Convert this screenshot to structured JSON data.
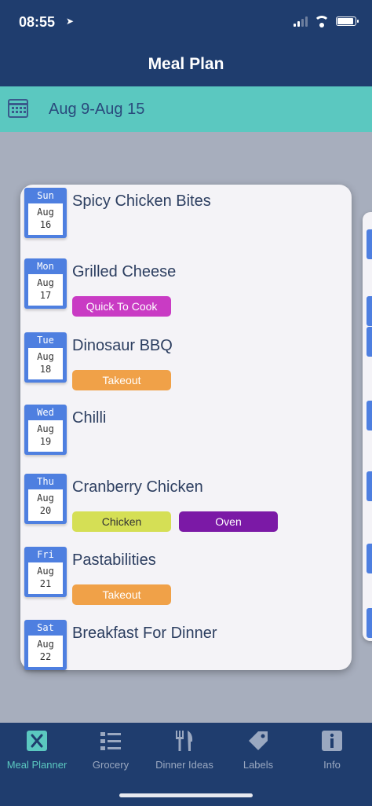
{
  "status_bar": {
    "time": "08:55",
    "location_icon": "location-arrow-icon"
  },
  "nav": {
    "title": "Meal Plan"
  },
  "week": {
    "range": "Aug 9-Aug 15",
    "icon": "calendar-icon"
  },
  "colors": {
    "nav_bg": "#1f3d6e",
    "accent_teal": "#5bc8c0",
    "date_chip": "#4e7fe0",
    "tag_magenta": "#c93bc4",
    "tag_orange": "#f0a148",
    "tag_yellow": "#d5df55",
    "tag_purple": "#7b19a6"
  },
  "days": [
    {
      "dow": "Sun",
      "month": "Aug",
      "day": "16",
      "meal": "Spicy Chicken Bites",
      "tags": []
    },
    {
      "dow": "Mon",
      "month": "Aug",
      "day": "17",
      "meal": "Grilled Cheese",
      "tags": [
        {
          "label": "Quick To Cook",
          "color": "#c93bc4",
          "text_color": "#ffffff"
        }
      ]
    },
    {
      "dow": "Tue",
      "month": "Aug",
      "day": "18",
      "meal": "Dinosaur BBQ",
      "tags": [
        {
          "label": "Takeout",
          "color": "#f0a148",
          "text_color": "#ffffff"
        }
      ]
    },
    {
      "dow": "Wed",
      "month": "Aug",
      "day": "19",
      "meal": "Chilli",
      "tags": []
    },
    {
      "dow": "Thu",
      "month": "Aug",
      "day": "20",
      "meal": "Cranberry Chicken",
      "tags": [
        {
          "label": "Chicken",
          "color": "#d5df55",
          "text_color": "#333333"
        },
        {
          "label": "Oven",
          "color": "#7b19a6",
          "text_color": "#ffffff"
        }
      ]
    },
    {
      "dow": "Fri",
      "month": "Aug",
      "day": "21",
      "meal": "Pastabilities",
      "tags": [
        {
          "label": "Takeout",
          "color": "#f0a148",
          "text_color": "#ffffff"
        }
      ]
    },
    {
      "dow": "Sat",
      "month": "Aug",
      "day": "22",
      "meal": "Breakfast For Dinner",
      "tags": []
    }
  ],
  "tabs": [
    {
      "label": "Meal Planner",
      "icon": "meal-planner-icon",
      "active": true
    },
    {
      "label": "Grocery",
      "icon": "grocery-list-icon",
      "active": false
    },
    {
      "label": "Dinner Ideas",
      "icon": "fork-knife-icon",
      "active": false
    },
    {
      "label": "Labels",
      "icon": "tag-icon",
      "active": false
    },
    {
      "label": "Info",
      "icon": "info-icon",
      "active": false
    }
  ]
}
